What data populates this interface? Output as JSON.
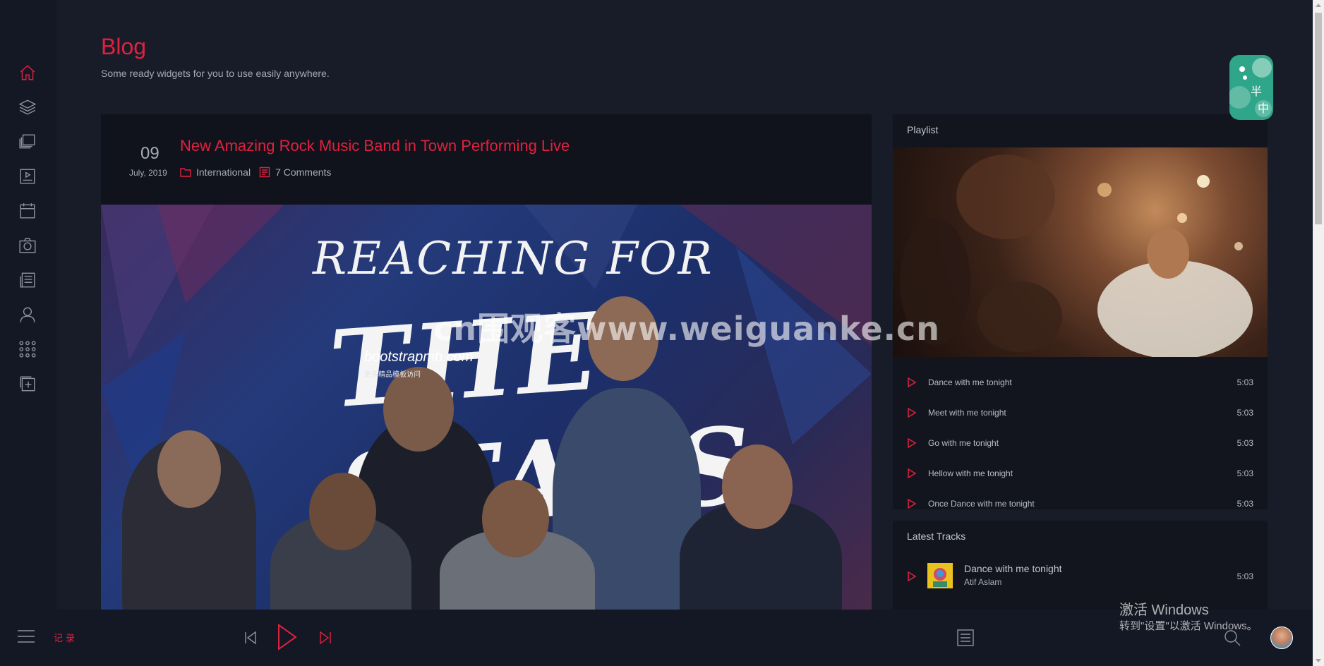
{
  "page": {
    "title": "Blog",
    "subtitle": "Some ready widgets for you to use easily anywhere."
  },
  "sidebar": {
    "items": [
      {
        "icon": "home-icon",
        "active": true
      },
      {
        "icon": "layers-icon",
        "active": false
      },
      {
        "icon": "gallery-icon",
        "active": false
      },
      {
        "icon": "video-icon",
        "active": false
      },
      {
        "icon": "calendar-icon",
        "active": false
      },
      {
        "icon": "camera-icon",
        "active": false
      },
      {
        "icon": "news-icon",
        "active": false
      },
      {
        "icon": "user-icon",
        "active": false
      },
      {
        "icon": "grid-icon",
        "active": false
      },
      {
        "icon": "add-page-icon",
        "active": false
      }
    ]
  },
  "post": {
    "day": "09",
    "month": "July, 2019",
    "title": "New Amazing Rock Music Band in Town Performing Live",
    "category": "International",
    "comments": "7 Comments",
    "poster_line1": "REACHING FOR",
    "poster_line2": "THE STARS",
    "poster_watermark": "bootstrapmb.com",
    "poster_watermark_sub": "更多精品模板访问"
  },
  "playlist": {
    "title": "Playlist",
    "tracks": [
      {
        "name": "Dance with me tonight",
        "duration": "5:03"
      },
      {
        "name": "Meet with me tonight",
        "duration": "5:03"
      },
      {
        "name": "Go with me tonight",
        "duration": "5:03"
      },
      {
        "name": "Hellow with me tonight",
        "duration": "5:03"
      },
      {
        "name": "Once Dance with me tonight",
        "duration": "5:03"
      }
    ]
  },
  "latest": {
    "title": "Latest Tracks",
    "tracks": [
      {
        "name": "Dance with me tonight",
        "artist": "Atif Aslam",
        "duration": "5:03"
      }
    ]
  },
  "badge": {
    "char1": "半",
    "char2": "中"
  },
  "player": {
    "record_label": "记录"
  },
  "overlays": {
    "site_watermark": "cn围观客www.weiguanke.cn",
    "windows_line1": "激活 Windows",
    "windows_line2": "转到\"设置\"以激活 Windows。"
  },
  "colors": {
    "accent": "#e0213f",
    "background": "#181c28",
    "card": "#12151e"
  }
}
